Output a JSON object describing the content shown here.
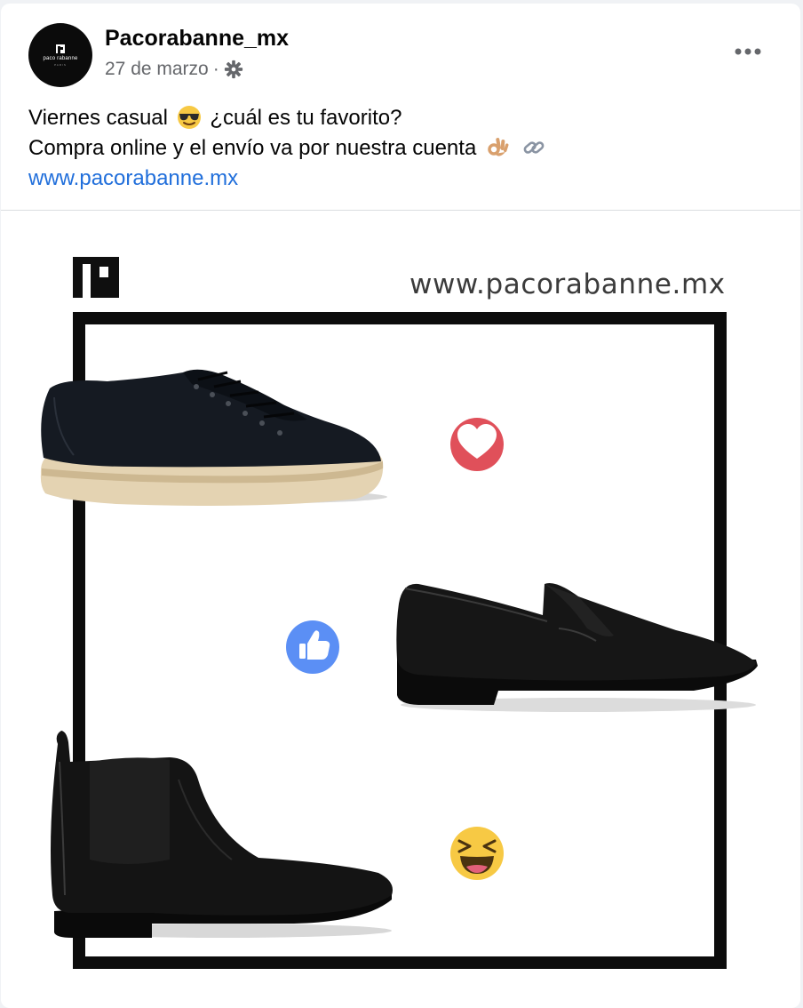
{
  "post": {
    "page_name": "Pacorabanne_mx",
    "date": "27 de marzo",
    "separator": "·",
    "privacy_icon": "gear-icon",
    "more_icon": "more-options-icon",
    "avatar": {
      "brand_text": "paco rabanne",
      "sub_text": "PARIS"
    },
    "text": {
      "line1_before_emoji": "Viernes casual",
      "line1_emoji": "sunglasses-emoji",
      "line1_after_emoji": "¿cuál es tu favorito?",
      "line2": "Compra online y el envío va por nuestra cuenta",
      "line2_emojis": [
        "ok-hand-emoji",
        "link-emoji"
      ],
      "link": "www.pacorabanne.mx"
    },
    "image": {
      "url_text": "www.pacorabanne.mx",
      "products": [
        "black-sneaker",
        "black-loafer",
        "black-chelsea-boot"
      ],
      "reactions": [
        "love-reaction-icon",
        "like-reaction-icon",
        "haha-reaction-icon"
      ]
    }
  },
  "colors": {
    "link": "#216fdb",
    "love": "#e0505a",
    "like": "#5b8ff5",
    "haha": "#f7c944",
    "secondary_text": "#65676b"
  }
}
